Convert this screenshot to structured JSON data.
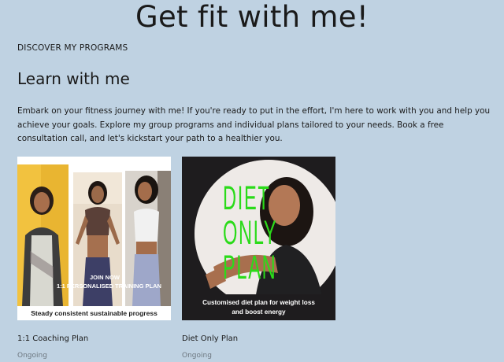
{
  "hero": {
    "title": "Get fit with me!"
  },
  "nav": {
    "discover_label": "DISCOVER MY PROGRAMS"
  },
  "section": {
    "heading": "Learn with me",
    "intro": "Embark on your fitness journey with me! If you're ready to put in the effort, I'm here to work with you and help you achieve your goals. Explore my group programs and individual plans tailored to your needs. Book a free consultation call, and let's kickstart your path to a healthier you."
  },
  "programs": [
    {
      "title": "1:1 Coaching Plan",
      "status": "Ongoing",
      "image": {
        "join_text": "JOIN NOW",
        "plan_text": "1:1 PERSONALISED TRAINING PLAN",
        "caption": "Steady consistent sustainable progress"
      }
    },
    {
      "title": "Diet Only Plan",
      "status": "Ongoing",
      "image": {
        "words": [
          "DIET",
          "ONLY",
          "PLAN"
        ],
        "caption_line1": "Customised diet plan for weight loss",
        "caption_line2": "and boost energy"
      }
    }
  ],
  "colors": {
    "page_background": "#bfd2e2",
    "diet_text": "#2bdb1a",
    "status_text": "#6d7780"
  }
}
